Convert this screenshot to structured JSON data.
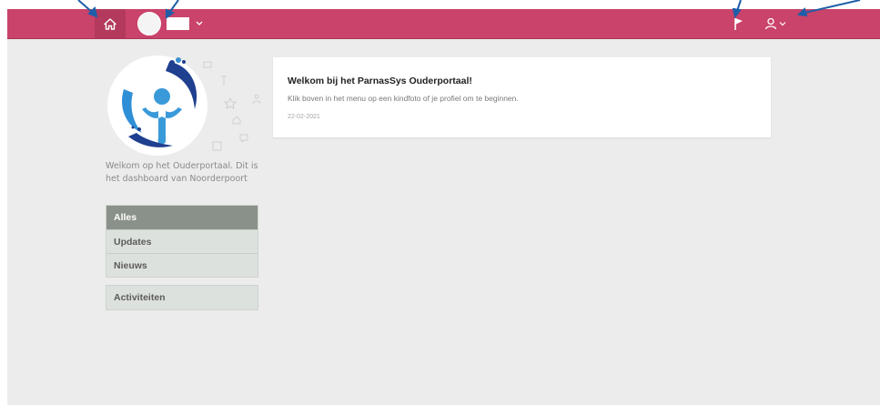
{
  "header": {
    "home_icon": "home-icon",
    "child_caret_icon": "chevron-down-icon",
    "flag_icon": "flag-icon",
    "user_icon": "user-icon",
    "accent_color": "#c9436a"
  },
  "sidebar": {
    "welcome_text": "Welkom op het Ouderportaal. Dit is het dashboard van Noorderpoort",
    "menu_items": [
      {
        "label": "Alles"
      },
      {
        "label": "Updates"
      },
      {
        "label": "Nieuws"
      }
    ],
    "activities_label": "Activiteiten"
  },
  "main": {
    "card": {
      "title": "Welkom bij het ParnasSys Ouderportaal!",
      "body": "Klik boven in het menu op een kindfoto of je profiel om te beginnen.",
      "date": "22-02-2021"
    }
  }
}
